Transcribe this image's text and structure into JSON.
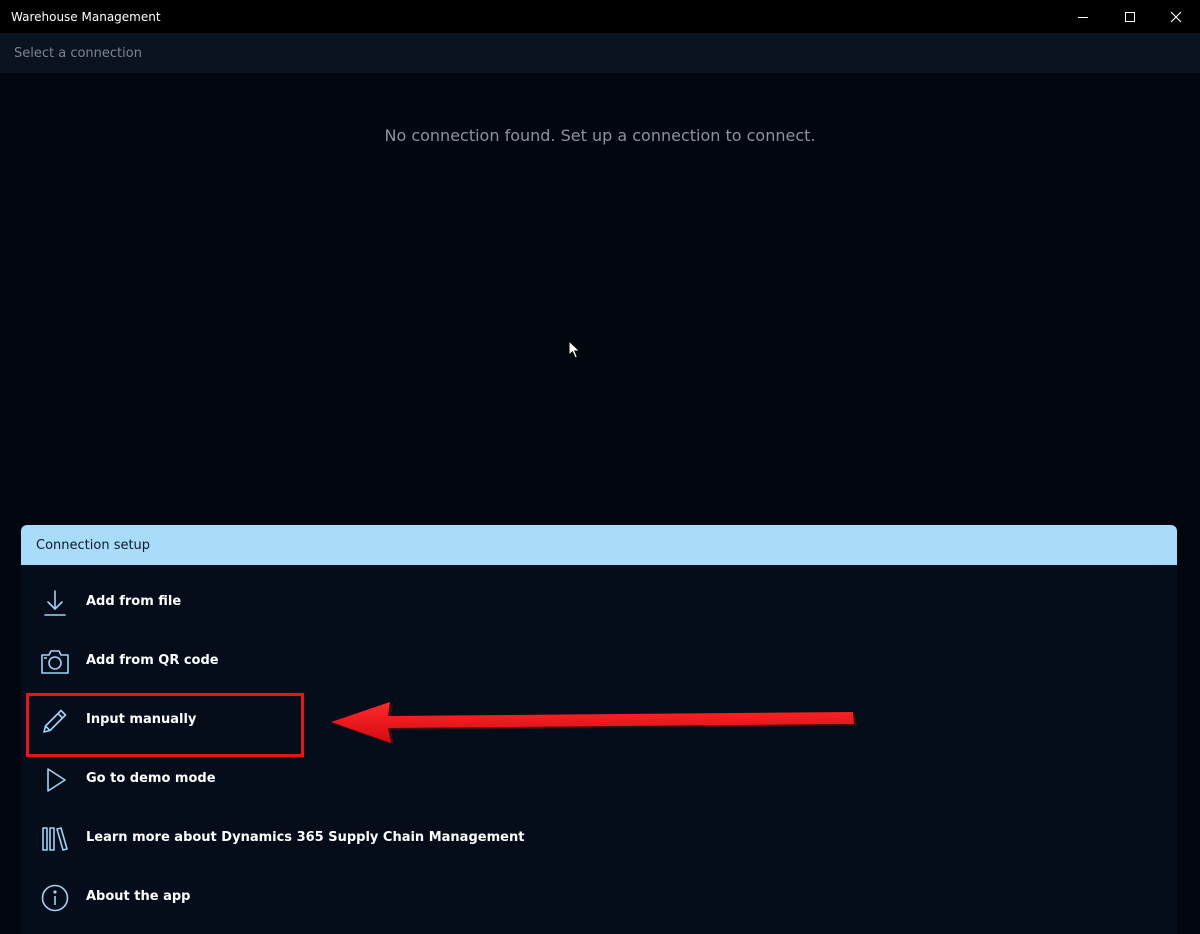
{
  "window": {
    "title": "Warehouse Management"
  },
  "header": {
    "subtitle": "Select a connection"
  },
  "main": {
    "empty_message": "No connection found. Set up a connection to connect."
  },
  "connection_setup": {
    "title": "Connection setup",
    "items": [
      {
        "label": "Add from file",
        "icon": "download-icon"
      },
      {
        "label": "Add from QR code",
        "icon": "camera-icon"
      },
      {
        "label": "Input manually",
        "icon": "pencil-icon"
      },
      {
        "label": "Go to demo mode",
        "icon": "play-icon"
      },
      {
        "label": "Learn more about Dynamics 365 Supply Chain Management",
        "icon": "library-icon"
      },
      {
        "label": "About the app",
        "icon": "info-icon"
      }
    ]
  },
  "colors": {
    "background": "#02070f",
    "panel_header": "#a8dcfa",
    "icon_accent": "#9fd3f5",
    "annotation_red": "#e8141c"
  }
}
